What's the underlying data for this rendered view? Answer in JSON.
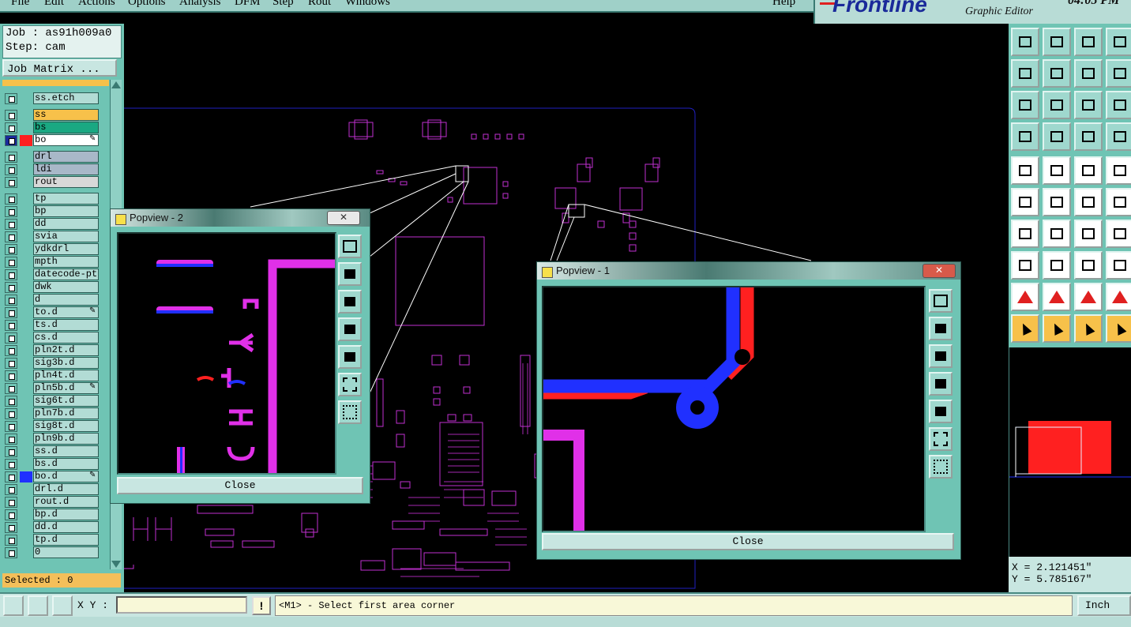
{
  "menu": {
    "items": [
      "File",
      "Edit",
      "Actions",
      "Options",
      "Analysis",
      "DFM",
      "Step",
      "Rout",
      "Windows"
    ],
    "help": "Help"
  },
  "brand": {
    "logo": "Frontline",
    "subtitle": "Graphic Editor",
    "clock": "04:05 PM"
  },
  "job": {
    "job_label": "Job : as91h009a0",
    "step_label": "Step: cam",
    "matrix_button": "Job Matrix ..."
  },
  "layers": [
    {
      "name": "ss.etch",
      "color": "#b2dcd5",
      "mark": ""
    },
    {
      "name": "ss",
      "color": "#f7c14a",
      "mark": ""
    },
    {
      "name": "bs",
      "color": "#1aa882",
      "mark": ""
    },
    {
      "name": "bo",
      "color": "#ffffff",
      "mark": "edit",
      "swatch": "#ff2020"
    },
    {
      "name": "drl",
      "color": "#a8b8c8",
      "mark": ""
    },
    {
      "name": "ldi",
      "color": "#a8b8c8",
      "mark": ""
    },
    {
      "name": "rout",
      "color": "#d8d8d8",
      "mark": ""
    },
    {
      "name": "tp",
      "color": "#b2dcd5",
      "mark": ""
    },
    {
      "name": "bp",
      "color": "#b2dcd5",
      "mark": ""
    },
    {
      "name": "dd",
      "color": "#b2dcd5",
      "mark": ""
    },
    {
      "name": "svia",
      "color": "#b2dcd5",
      "mark": ""
    },
    {
      "name": "ydkdrl",
      "color": "#b2dcd5",
      "mark": ""
    },
    {
      "name": "mpth",
      "color": "#b2dcd5",
      "mark": ""
    },
    {
      "name": "datecode-pte",
      "color": "#b2dcd5",
      "mark": ""
    },
    {
      "name": "dwk",
      "color": "#b2dcd5",
      "mark": ""
    },
    {
      "name": "d",
      "color": "#b2dcd5",
      "mark": ""
    },
    {
      "name": "to.d",
      "color": "#b2dcd5",
      "mark": "pen"
    },
    {
      "name": "ts.d",
      "color": "#b2dcd5",
      "mark": ""
    },
    {
      "name": "cs.d",
      "color": "#b2dcd5",
      "mark": ""
    },
    {
      "name": "pln2t.d",
      "color": "#b2dcd5",
      "mark": ""
    },
    {
      "name": "sig3b.d",
      "color": "#b2dcd5",
      "mark": ""
    },
    {
      "name": "pln4t.d",
      "color": "#b2dcd5",
      "mark": ""
    },
    {
      "name": "pln5b.d",
      "color": "#b2dcd5",
      "mark": "pen"
    },
    {
      "name": "sig6t.d",
      "color": "#b2dcd5",
      "mark": ""
    },
    {
      "name": "pln7b.d",
      "color": "#b2dcd5",
      "mark": ""
    },
    {
      "name": "sig8t.d",
      "color": "#b2dcd5",
      "mark": ""
    },
    {
      "name": "pln9b.d",
      "color": "#b2dcd5",
      "mark": ""
    },
    {
      "name": "ss.d",
      "color": "#b2dcd5",
      "mark": ""
    },
    {
      "name": "bs.d",
      "color": "#b2dcd5",
      "mark": ""
    },
    {
      "name": "bo.d",
      "color": "#b2dcd5",
      "mark": "pen",
      "swatch": "#2030ff"
    },
    {
      "name": "drl.d",
      "color": "#b2dcd5",
      "mark": ""
    },
    {
      "name": "rout.d",
      "color": "#b2dcd5",
      "mark": ""
    },
    {
      "name": "bp.d",
      "color": "#b2dcd5",
      "mark": ""
    },
    {
      "name": "dd.d",
      "color": "#b2dcd5",
      "mark": ""
    },
    {
      "name": "tp.d",
      "color": "#b2dcd5",
      "mark": ""
    },
    {
      "name": "0",
      "color": "#b2dcd5",
      "mark": ""
    }
  ],
  "selected": "Selected : 0",
  "status": {
    "xy_label": "X Y :",
    "xy_value": "",
    "message": "<M1> - Select first area corner",
    "units": "Inch"
  },
  "coords": {
    "x": "X = 2.121451\"",
    "y": "Y = 5.785167\""
  },
  "popview2": {
    "title": "Popview - 2",
    "close": "Close"
  },
  "popview1": {
    "title": "Popview - 1",
    "close": "Close"
  },
  "colors": {
    "panel": "#6fc4b4",
    "magenta": "#e030e8",
    "blue": "#2030ff",
    "red": "#ff2020",
    "outline": "#a020c0"
  }
}
